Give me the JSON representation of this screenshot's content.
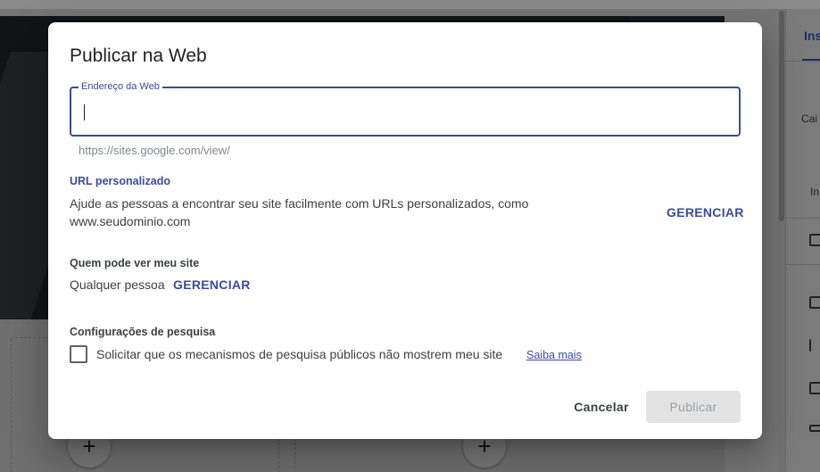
{
  "background": {
    "panel_tab": "Ins",
    "panel_texts": [
      "Cai",
      "In"
    ],
    "plus_glyph": "+"
  },
  "dialog": {
    "title": "Publicar na Web",
    "web_address": {
      "label": "Endereço da Web",
      "value": "",
      "url_prefix": "https://sites.google.com/view/"
    },
    "custom_url": {
      "heading": "URL personalizado",
      "description_line1": "Ajude as pessoas a encontrar seu site facilmente com URLs personalizados, como",
      "description_line2": "www.seudominio.com",
      "manage_label": "GERENCIAR"
    },
    "who_can_see": {
      "heading": "Quem pode ver meu site",
      "value": "Qualquer pessoa",
      "manage_label": "GERENCIAR"
    },
    "search_settings": {
      "heading": "Configurações de pesquisa",
      "checkbox_label": "Solicitar que os mecanismos de pesquisa públicos não mostrem meu site",
      "checked": false,
      "learn_more": "Saiba mais"
    },
    "actions": {
      "cancel_label": "Cancelar",
      "publish_label": "Publicar",
      "publish_enabled": false
    }
  },
  "colors": {
    "accent": "#3c4a9a",
    "scrim": "#7a7a7a",
    "disabled_button": "#e3e3e3"
  }
}
